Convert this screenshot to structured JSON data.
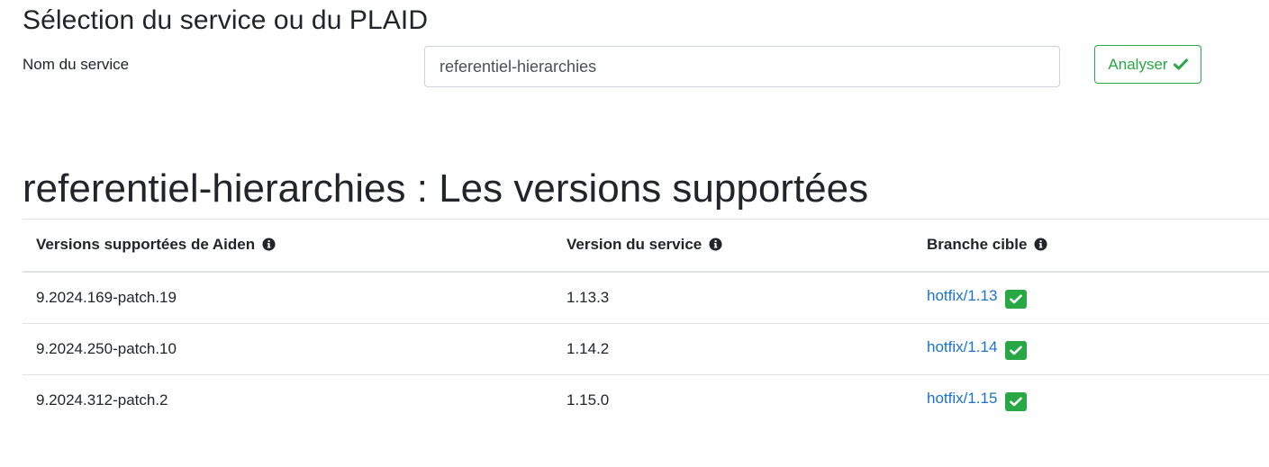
{
  "selection": {
    "title": "Sélection du service ou du PLAID",
    "service_label": "Nom du service",
    "service_value": "referentiel-hierarchies",
    "analyse_label": "Analyser",
    "analyse_icon": "check-icon"
  },
  "versions": {
    "title": "referentiel-hierarchies : Les versions supportées",
    "columns": [
      {
        "label": "Versions supportées de Aiden",
        "icon": "info-circle-icon"
      },
      {
        "label": "Version du service",
        "icon": "info-circle-icon"
      },
      {
        "label": "Branche cible",
        "icon": "info-circle-icon"
      }
    ],
    "rows": [
      {
        "aiden_version": "9.2024.169-patch.19",
        "service_version": "1.13.3",
        "branch": "hotfix/1.13",
        "status_icon": "check-square-icon"
      },
      {
        "aiden_version": "9.2024.250-patch.10",
        "service_version": "1.14.2",
        "branch": "hotfix/1.14",
        "status_icon": "check-square-icon"
      },
      {
        "aiden_version": "9.2024.312-patch.2",
        "service_version": "1.15.0",
        "branch": "hotfix/1.15",
        "status_icon": "check-square-icon"
      }
    ]
  },
  "colors": {
    "success": "#28a745",
    "link": "#1a73c8",
    "text": "#212529",
    "border": "#dee2e6"
  }
}
